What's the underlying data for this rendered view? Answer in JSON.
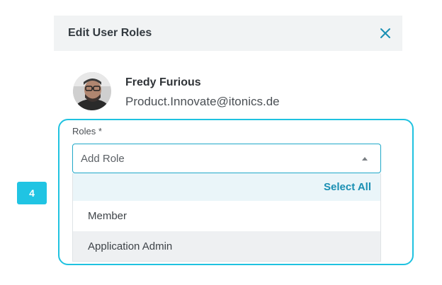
{
  "dialog": {
    "title": "Edit User Roles",
    "close_icon": "close-icon"
  },
  "user": {
    "name": "Fredy Furious",
    "email": "Product.Innovate@itonics.de",
    "avatar_icon": "avatar-photo"
  },
  "roles": {
    "label": "Roles *",
    "placeholder": "Add Role",
    "caret_icon": "caret-up-icon",
    "select_all_label": "Select All",
    "options": [
      {
        "label": "Member"
      },
      {
        "label": "Application Admin"
      }
    ]
  },
  "annotation": {
    "step_number": "4"
  },
  "colors": {
    "accent": "#1fc2e0",
    "link": "#1a8fb3",
    "header_bg": "#f1f3f4"
  }
}
